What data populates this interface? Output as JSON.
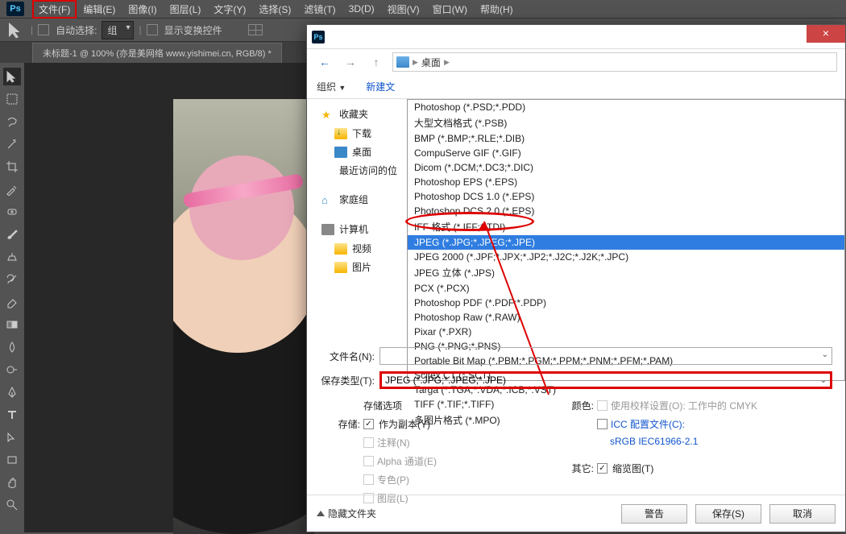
{
  "menubar": {
    "items": [
      "文件(F)",
      "编辑(E)",
      "图像(I)",
      "图层(L)",
      "文字(Y)",
      "选择(S)",
      "滤镜(T)",
      "3D(D)",
      "视图(V)",
      "窗口(W)",
      "帮助(H)"
    ]
  },
  "optbar": {
    "autoSelect": "自动选择:",
    "group": "组",
    "showTransform": "显示变换控件"
  },
  "docTab": "未标题-1 @ 100% (亦是美网络 www.yishimei.cn, RGB/8) *",
  "dialog": {
    "crumb": "桌面",
    "toolbar": {
      "organize": "组织",
      "newFolder": "新建文",
      "caret": "▼"
    },
    "sidebar": {
      "fav": "收藏夹",
      "downloads": "下载",
      "desktop": "桌面",
      "recent": "最近访问的位",
      "homegroup": "家庭组",
      "computer": "计算机",
      "videos": "视频",
      "pictures": "图片"
    },
    "formats": [
      "Photoshop (*.PSD;*.PDD)",
      "大型文档格式 (*.PSB)",
      "BMP (*.BMP;*.RLE;*.DIB)",
      "CompuServe GIF (*.GIF)",
      "Dicom (*.DCM;*.DC3;*.DIC)",
      "Photoshop EPS (*.EPS)",
      "Photoshop DCS 1.0 (*.EPS)",
      "Photoshop DCS 2.0 (*.EPS)",
      "IFF 格式 (*.IFF;*.TDI)",
      "JPEG (*.JPG;*.JPEG;*.JPE)",
      "JPEG 2000 (*.JPF;*.JPX;*.JP2;*.J2C;*.J2K;*.JPC)",
      "JPEG 立体 (*.JPS)",
      "PCX (*.PCX)",
      "Photoshop PDF (*.PDF;*.PDP)",
      "Photoshop Raw (*.RAW)",
      "Pixar (*.PXR)",
      "PNG (*.PNG;*.PNS)",
      "Portable Bit Map (*.PBM;*.PGM;*.PPM;*.PNM;*.PFM;*.PAM)",
      "Scitex CT (*.SCT)",
      "Targa (*.TGA;*.VDA;*.ICB;*.VST)",
      "TIFF (*.TIF;*.TIFF)",
      "多图片格式 (*.MPO)"
    ],
    "fileNameLabel": "文件名(N):",
    "fileTypeLabel": "保存类型(T):",
    "fileTypeValue": "JPEG (*.JPG;*.JPEG;*.JPE)",
    "storeOptions": "存储选项",
    "storeLabel": "存储:",
    "asCopy": "作为副本(Y)",
    "notes": "注释(N)",
    "alpha": "Alpha 通道(E)",
    "spot": "专色(P)",
    "layers": "图层(L)",
    "colorLabel": "颜色:",
    "useProof": "使用校样设置(O): 工作中的 CMYK",
    "iccProfile": "ICC 配置文件(C):",
    "iccValue": "sRGB IEC61966-2.1",
    "otherLabel": "其它:",
    "thumbnail": "缩览图(T)",
    "hideFolders": "隐藏文件夹",
    "warn": "警告",
    "save": "保存(S)",
    "cancel": "取消"
  }
}
